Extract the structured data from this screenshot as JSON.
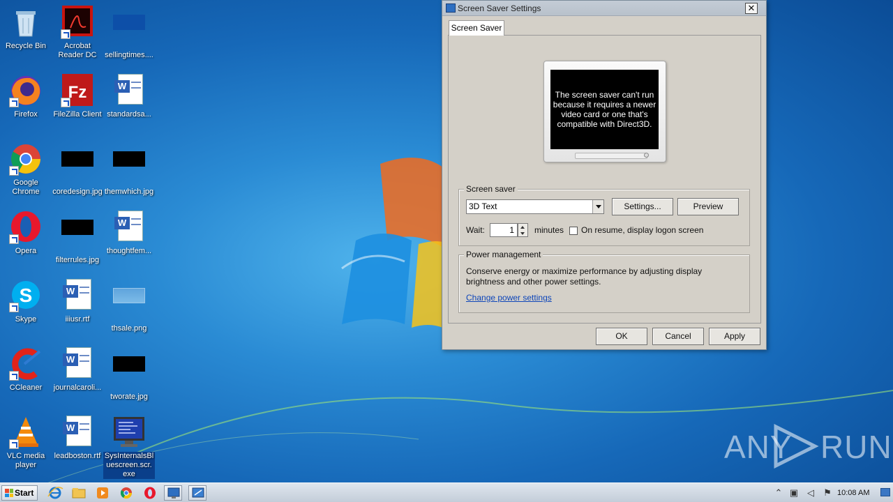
{
  "desktop": {
    "icons": [
      {
        "label": "Recycle Bin",
        "icon": "recycle-bin-icon"
      },
      {
        "label": "Acrobat Reader DC",
        "icon": "acrobat-reader-icon"
      },
      {
        "label": "sellingtimes....",
        "icon": "image-file-icon"
      },
      {
        "label": "Firefox",
        "icon": "firefox-icon"
      },
      {
        "label": "FileZilla Client",
        "icon": "filezilla-icon"
      },
      {
        "label": "standardsa...",
        "icon": "word-document-icon"
      },
      {
        "label": "Google Chrome",
        "icon": "chrome-icon"
      },
      {
        "label": "coredesign.jpg",
        "icon": "image-file-icon"
      },
      {
        "label": "themwhich.jpg",
        "icon": "image-file-icon"
      },
      {
        "label": "Opera",
        "icon": "opera-icon"
      },
      {
        "label": "filterrules.jpg",
        "icon": "image-file-icon"
      },
      {
        "label": "thoughtfem...",
        "icon": "word-document-icon"
      },
      {
        "label": "Skype",
        "icon": "skype-icon"
      },
      {
        "label": "iiiusr.rtf",
        "icon": "word-document-icon"
      },
      {
        "label": "thsale.png",
        "icon": "image-file-icon"
      },
      {
        "label": "CCleaner",
        "icon": "ccleaner-icon"
      },
      {
        "label": "journalcaroli...",
        "icon": "word-document-icon"
      },
      {
        "label": "tworate.jpg",
        "icon": "image-file-icon"
      },
      {
        "label": "VLC media player",
        "icon": "vlc-icon"
      },
      {
        "label": "leadboston.rtf",
        "icon": "word-document-icon"
      },
      {
        "label": "SysInternalsBluescreen.scr.exe",
        "icon": "screensaver-exe-icon",
        "display": "SysInternalsBl uescreen.scr. exe"
      }
    ]
  },
  "watermark": {
    "text_left": "ANY",
    "text_right": "RUN"
  },
  "dialog": {
    "title": "Screen Saver Settings",
    "close_label": "✕",
    "tab_label": "Screen Saver",
    "preview_message": "The screen saver can't run because it requires a newer video card or one that's compatible with Direct3D.",
    "screen_saver_group": {
      "label": "Screen saver",
      "selected_value": "3D Text",
      "settings_button": "Settings...",
      "preview_button": "Preview",
      "wait_label": "Wait:",
      "wait_value": "1",
      "minutes_label": "minutes",
      "resume_checkbox_label": "On resume, display logon screen",
      "resume_checked": false
    },
    "power_group": {
      "label": "Power management",
      "description": "Conserve energy or maximize performance by adjusting display brightness and other power settings.",
      "link_text": "Change power settings"
    },
    "buttons": {
      "ok": "OK",
      "cancel": "Cancel",
      "apply": "Apply"
    }
  },
  "taskbar": {
    "start_label": "Start",
    "pinned": [
      "internet-explorer-icon",
      "file-explorer-icon",
      "media-player-icon",
      "chrome-icon",
      "opera-icon",
      "screen-saver-settings-icon",
      "control-panel-icon"
    ],
    "tray_icons": [
      "show-hidden-icons-icon",
      "network-icon",
      "volume-icon",
      "action-center-flag-icon"
    ],
    "clock": "10:08 AM"
  },
  "colors": {
    "desktop_blue": "#1668b8",
    "dialog_face": "#d4d0c8",
    "link_blue": "#0d45b9"
  }
}
